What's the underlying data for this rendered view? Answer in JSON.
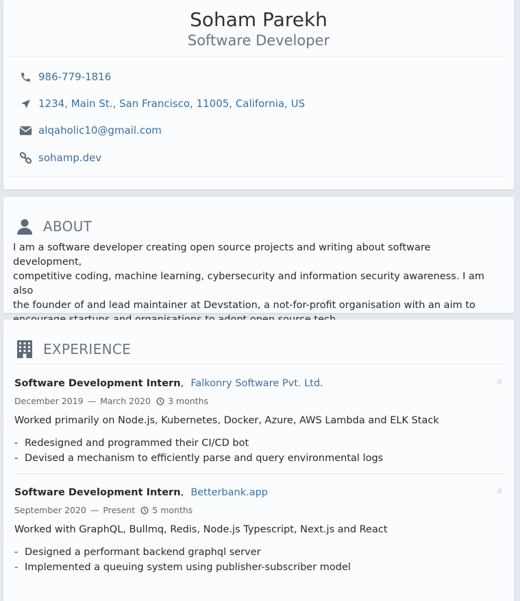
{
  "header": {
    "name": "Soham Parekh",
    "role": "Software Developer",
    "contacts": [
      {
        "icon": "phone-icon",
        "text": "986-779-1816"
      },
      {
        "icon": "location-arrow-icon",
        "text": "1234, Main St., San Francisco, 11005, California, US"
      },
      {
        "icon": "envelope-icon",
        "text": "alqaholic10@gmail.com"
      },
      {
        "icon": "link-icon",
        "text": "sohamp.dev"
      }
    ]
  },
  "about": {
    "heading": "ABOUT",
    "icon": "user-icon",
    "lines": [
      "I am a software developer creating open source projects and writing about software development,",
      "competitive coding, machine learning, cybersecurity and information security awareness. I am also",
      "the founder of and lead maintainer at Devstation, a not-for-profit organisation with an aim to",
      "encourage startups and organisations to adopt open source tech."
    ]
  },
  "experience": {
    "heading": "EXPERIENCE",
    "icon": "building-icon",
    "jobs": [
      {
        "title": "Software Development Intern",
        "company": "Falkonry Software Pvt. Ltd.",
        "hash": "#",
        "start": "December 2019",
        "end": "March 2020",
        "duration": "3 months",
        "summary": "Worked primarily on Node.js, Kubernetes, Docker, Azure, AWS Lambda and ELK Stack",
        "bullets": [
          "Redesigned and programmed their CI/CD bot",
          "Devised a mechanism to efficiently parse and query environmental logs"
        ]
      },
      {
        "title": "Software Development Intern",
        "company": "Betterbank.app",
        "hash": "#",
        "start": "September 2020",
        "end": "Present",
        "duration": "5 months",
        "summary": "Worked with GraphQL, Bullmq, Redis, Node.js Typescript, Next.js and React",
        "bullets": [
          "Designed a performant backend graphql server",
          "Implemented a queuing system using publisher-subscriber model"
        ]
      }
    ]
  },
  "colors": {
    "background": "#e3e8ee",
    "card": "#fbfcfd",
    "link": "#3c6f9e",
    "heading": "#6a7683",
    "icon": "#5e6b78"
  }
}
